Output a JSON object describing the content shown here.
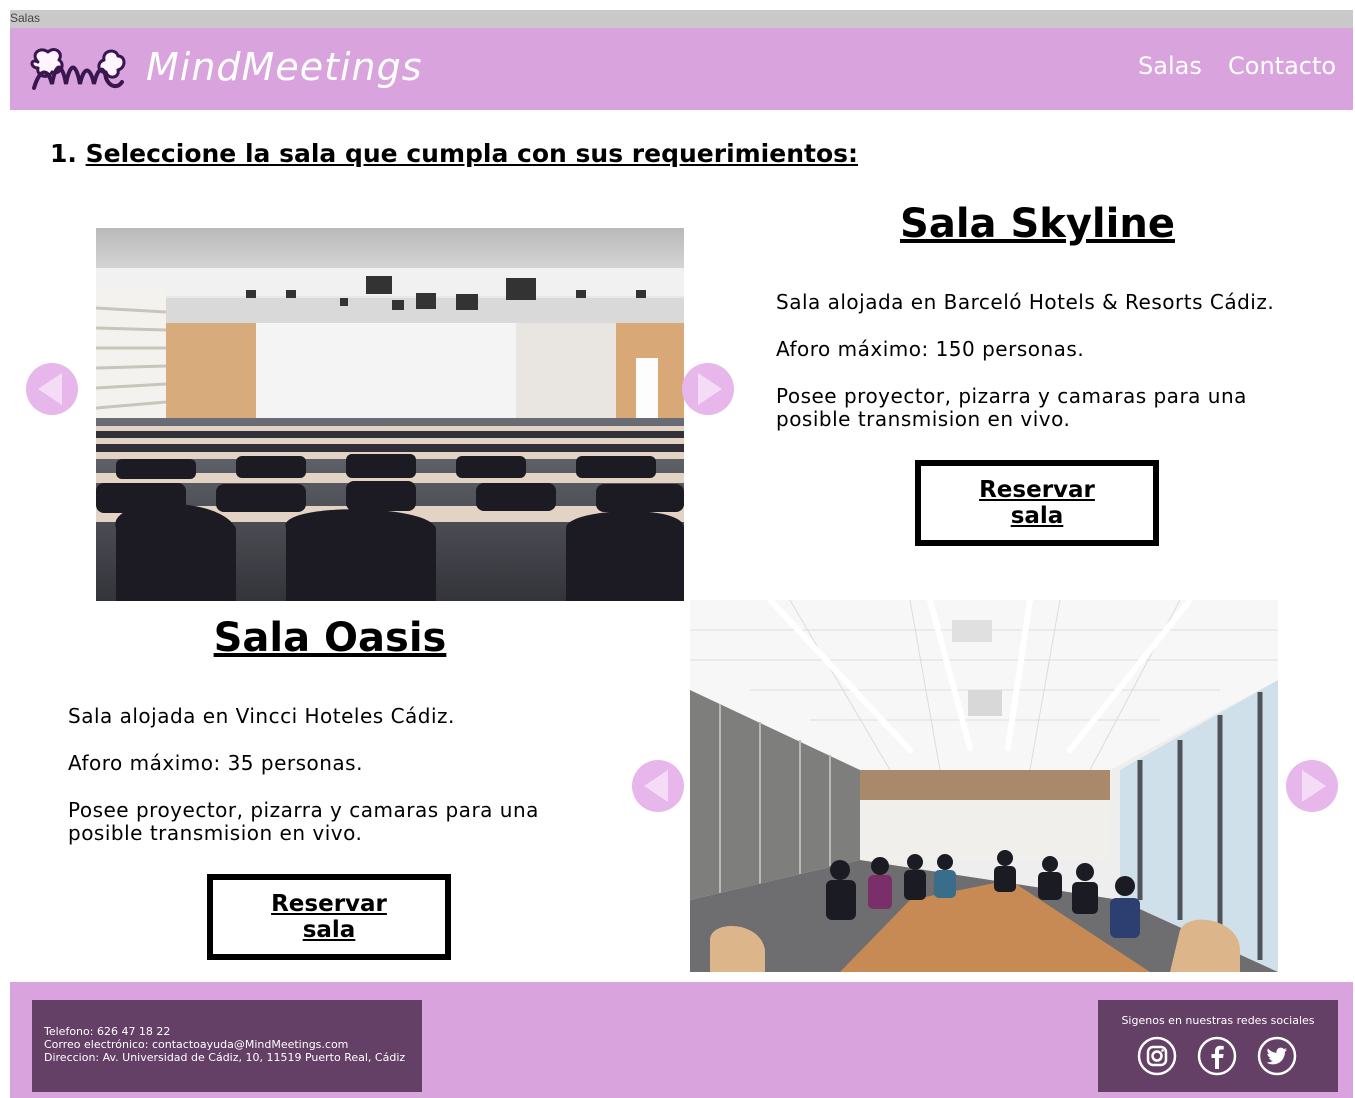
{
  "tab": {
    "label": "Salas"
  },
  "header": {
    "brand": "MindMeetings",
    "nav": [
      {
        "label": "Salas"
      },
      {
        "label": "Contacto"
      }
    ]
  },
  "main": {
    "step_number": "1.",
    "heading": "Seleccione la sala que cumpla con sus requerimientos:",
    "rooms": [
      {
        "title": "Sala Skyline",
        "location": "Sala alojada en Barceló Hotels & Resorts Cádiz.",
        "capacity": "Aforo máximo: 150 personas.",
        "features_line1": "Posee proyector, pizarra y camaras para una",
        "features_line2": "posible transmision en vivo.",
        "button_line1": "Reservar",
        "button_line2": "sala"
      },
      {
        "title": "Sala Oasis",
        "location": "Sala alojada en Vincci Hoteles Cádiz.",
        "capacity": "Aforo máximo: 35 personas.",
        "features_line1": "Posee proyector, pizarra y camaras para una",
        "features_line2": "posible transmision en vivo.",
        "button_line1": "Reservar",
        "button_line2": "sala"
      }
    ]
  },
  "footer": {
    "phone": "Telefono: 626 47 18 22",
    "email": "Correo electrónico: contactoayuda@MindMeetings.com",
    "address": "Direccion: Av. Universidad de Cádiz, 10, 11519 Puerto Real, Cádiz",
    "social_label": "Sigenos en nuestras redes sociales",
    "social_icons": [
      "instagram-icon",
      "facebook-icon",
      "twitter-icon"
    ]
  },
  "colors": {
    "header_bg": "#d9a3dd",
    "footer_box": "#643f66",
    "arrow": "#e7b6ea",
    "logo_outline": "#3a1650"
  }
}
